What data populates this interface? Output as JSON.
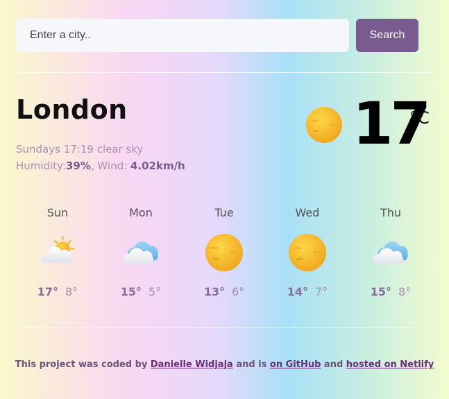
{
  "search": {
    "placeholder": "Enter a city..",
    "button_label": "Search"
  },
  "current": {
    "city": "London",
    "datetime_desc": "Sundays 17:19 clear sky",
    "humidity_label": "Humidity:",
    "humidity_value": "39%",
    "wind_label": ", Wind: ",
    "wind_value": "4.02km/h",
    "temperature": "17",
    "unit": "°C",
    "icon": "sun-icon"
  },
  "forecast": [
    {
      "day": "Sun",
      "max": "17°",
      "min": "8°",
      "icon": "partly-cloudy-icon"
    },
    {
      "day": "Mon",
      "max": "15°",
      "min": "5°",
      "icon": "cloud-icon"
    },
    {
      "day": "Tue",
      "max": "13°",
      "min": "6°",
      "icon": "sun-icon"
    },
    {
      "day": "Wed",
      "max": "14°",
      "min": "7°",
      "icon": "sun-icon"
    },
    {
      "day": "Thu",
      "max": "15°",
      "min": "8°",
      "icon": "cloud-icon"
    }
  ],
  "footer": {
    "text1": "This project was coded by ",
    "author_link": "Danielle Widjaja",
    "text2": " and is ",
    "github_link": "on GitHub",
    "text3": " and ",
    "netlify_link": "hosted on Netlify"
  },
  "colors": {
    "accent": "#7a5b8f",
    "link": "#6a2f78"
  }
}
